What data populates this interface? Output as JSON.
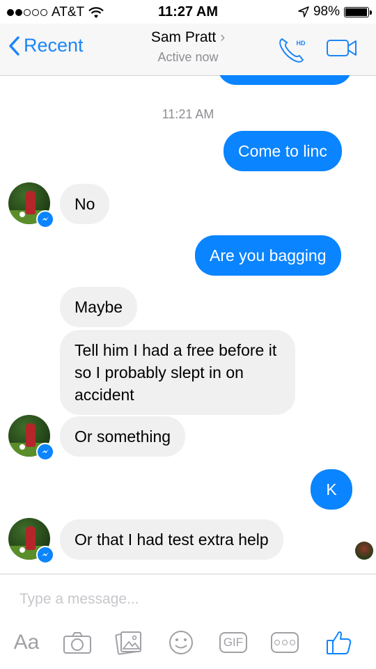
{
  "status_bar": {
    "carrier": "AT&T",
    "time": "11:27 AM",
    "battery_percent": "98%",
    "battery_level": 0.98
  },
  "nav": {
    "back_label": "Recent",
    "contact_name": "Sam Pratt",
    "contact_status": "Active now",
    "call_badge": "HD"
  },
  "conversation": {
    "timestamp": "11:21 AM",
    "messages": [
      {
        "id": "m1",
        "direction": "outgoing",
        "text": "Come to linc"
      },
      {
        "id": "m2",
        "direction": "incoming",
        "text": "No"
      },
      {
        "id": "m3",
        "direction": "outgoing",
        "text": "Are you bagging"
      },
      {
        "id": "m4",
        "direction": "incoming",
        "text": "Maybe"
      },
      {
        "id": "m5",
        "direction": "incoming",
        "text": "Tell him I had a free before it so I probably slept in on accident"
      },
      {
        "id": "m6",
        "direction": "incoming",
        "text": "Or something"
      },
      {
        "id": "m7",
        "direction": "outgoing",
        "text": "K"
      },
      {
        "id": "m8",
        "direction": "incoming",
        "text": "Or that I had test extra help"
      }
    ]
  },
  "composer": {
    "placeholder": "Type a message...",
    "toolbar": {
      "text_label": "Aa",
      "gif_label": "GIF"
    }
  },
  "colors": {
    "accent": "#0a84ff",
    "incoming_bubble": "#f1f0f0",
    "muted": "#8e8e93"
  }
}
